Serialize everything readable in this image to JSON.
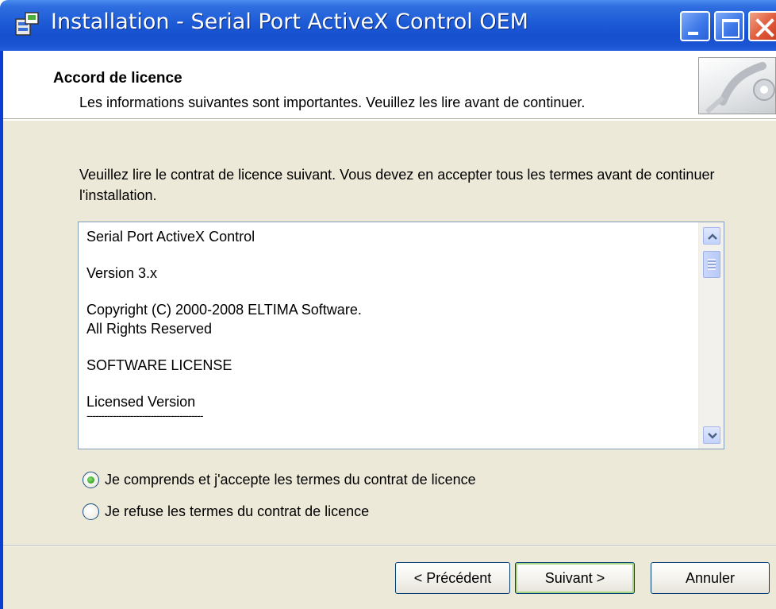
{
  "window": {
    "title": "Installation - Serial Port ActiveX Control OEM",
    "icon": "setup-icon",
    "controls": [
      "minimize-icon",
      "maximize-icon",
      "close-icon"
    ]
  },
  "header": {
    "title": "Accord de licence",
    "subtitle": "Les informations suivantes sont importantes. Veuillez les lire avant de continuer."
  },
  "body": {
    "intro": "Veuillez lire le contrat de licence suivant. Vous devez en accepter tous les termes avant de continuer l'installation.",
    "license_lines": [
      "Serial Port ActiveX Control",
      "Version 3.x",
      "Copyright (C) 2000-2008 ELTIMA Software.",
      "All Rights Reserved",
      "SOFTWARE LICENSE",
      "Licensed Version",
      "----------------------------------------"
    ],
    "options": [
      {
        "label": "Je comprends et j'accepte les termes du contrat de licence",
        "checked": true
      },
      {
        "label": "Je refuse les termes du contrat de licence",
        "checked": false
      }
    ]
  },
  "footer": {
    "back_label": "< Précédent",
    "next_label": "Suivant >",
    "cancel_label": "Annuler"
  },
  "colors": {
    "titlebar": "#1d5bd6",
    "dialog_bg": "#ece9d8",
    "radio_checked": "#33a821",
    "close_button": "#e0583a"
  }
}
